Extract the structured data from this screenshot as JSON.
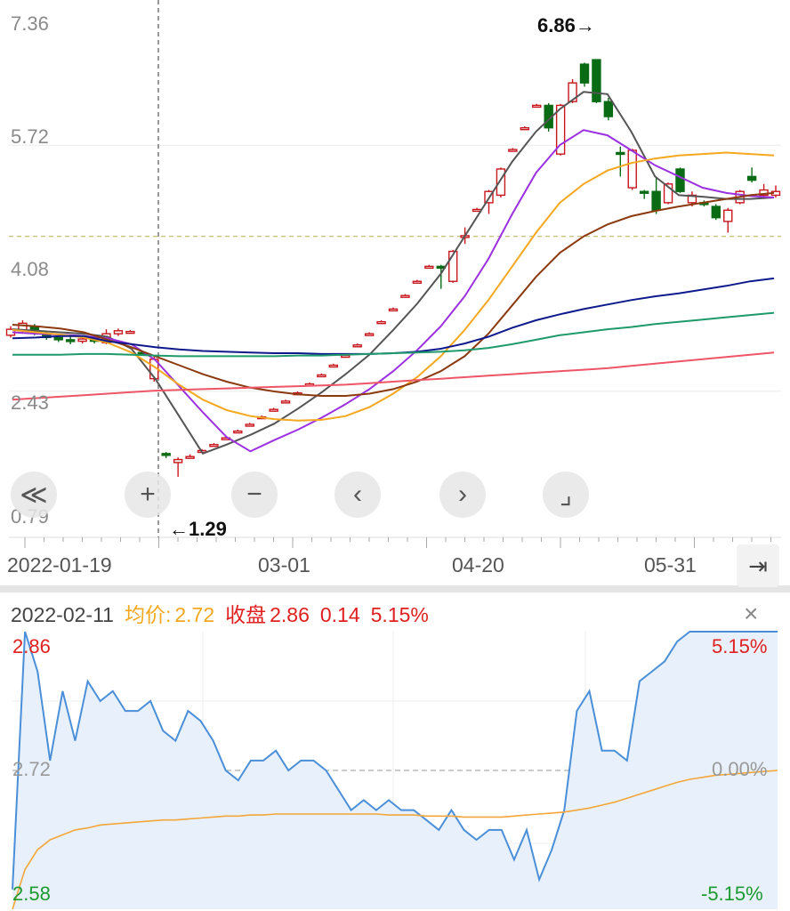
{
  "chart_data": [
    {
      "type": "candlestick",
      "y_ticks": [
        "7.36",
        "5.72",
        "4.08",
        "2.43",
        "0.79"
      ],
      "ylim": [
        0.79,
        7.36
      ],
      "x_ticks": [
        "2022-01-19",
        "03-01",
        "04-20",
        "05-31"
      ],
      "high_label": "6.86→",
      "low_label": "←1.29",
      "cursor_date": "2022-02-11",
      "candles": [
        {
          "o": 3.18,
          "c": 3.26,
          "h": 3.3,
          "l": 3.15
        },
        {
          "o": 3.24,
          "c": 3.34,
          "h": 3.38,
          "l": 3.2
        },
        {
          "o": 3.3,
          "c": 3.22,
          "h": 3.33,
          "l": 3.18
        },
        {
          "o": 3.2,
          "c": 3.15,
          "h": 3.24,
          "l": 3.12
        },
        {
          "o": 3.15,
          "c": 3.12,
          "h": 3.18,
          "l": 3.09
        },
        {
          "o": 3.12,
          "c": 3.1,
          "h": 3.16,
          "l": 3.06
        },
        {
          "o": 3.1,
          "c": 3.13,
          "h": 3.16,
          "l": 3.07
        },
        {
          "o": 3.14,
          "c": 3.1,
          "h": 3.19,
          "l": 3.07
        },
        {
          "o": 3.08,
          "c": 3.2,
          "h": 3.26,
          "l": 3.06
        },
        {
          "o": 3.2,
          "c": 3.24,
          "h": 3.27,
          "l": 3.17
        },
        {
          "o": 3.22,
          "c": 3.23,
          "h": 3.25,
          "l": 3.2
        },
        {
          "o": 2.95,
          "c": 2.93,
          "h": 2.97,
          "l": 2.91
        },
        {
          "o": 2.6,
          "c": 2.86,
          "h": 2.9,
          "l": 2.56
        },
        {
          "o": 1.6,
          "c": 1.59,
          "h": 1.62,
          "l": 1.54
        },
        {
          "o": 1.48,
          "c": 1.52,
          "h": 1.55,
          "l": 1.29
        },
        {
          "o": 1.55,
          "c": 1.56,
          "h": 1.59,
          "l": 1.54
        },
        {
          "o": 1.63,
          "c": 1.64,
          "h": 1.66,
          "l": 1.62
        },
        {
          "o": 1.71,
          "c": 1.72,
          "h": 1.74,
          "l": 1.7
        },
        {
          "o": 1.8,
          "c": 1.81,
          "h": 1.83,
          "l": 1.79
        },
        {
          "o": 1.89,
          "c": 1.9,
          "h": 1.92,
          "l": 1.88
        },
        {
          "o": 1.98,
          "c": 1.99,
          "h": 2.01,
          "l": 1.97
        },
        {
          "o": 2.08,
          "c": 2.09,
          "h": 2.11,
          "l": 2.07
        },
        {
          "o": 2.18,
          "c": 2.19,
          "h": 2.21,
          "l": 2.17
        },
        {
          "o": 2.29,
          "c": 2.3,
          "h": 2.32,
          "l": 2.28
        },
        {
          "o": 2.4,
          "c": 2.41,
          "h": 2.43,
          "l": 2.39
        },
        {
          "o": 2.52,
          "c": 2.53,
          "h": 2.55,
          "l": 2.51
        },
        {
          "o": 2.64,
          "c": 2.65,
          "h": 2.67,
          "l": 2.63
        },
        {
          "o": 2.77,
          "c": 2.78,
          "h": 2.8,
          "l": 2.76
        },
        {
          "o": 2.9,
          "c": 2.91,
          "h": 2.93,
          "l": 2.89
        },
        {
          "o": 3.04,
          "c": 3.05,
          "h": 3.07,
          "l": 3.03
        },
        {
          "o": 3.19,
          "c": 3.2,
          "h": 3.22,
          "l": 3.18
        },
        {
          "o": 3.35,
          "c": 3.36,
          "h": 3.38,
          "l": 3.34
        },
        {
          "o": 3.52,
          "c": 3.53,
          "h": 3.55,
          "l": 3.51
        },
        {
          "o": 3.7,
          "c": 3.71,
          "h": 3.73,
          "l": 3.69
        },
        {
          "o": 3.89,
          "c": 3.9,
          "h": 3.92,
          "l": 3.88
        },
        {
          "o": 4.09,
          "c": 4.1,
          "h": 4.12,
          "l": 4.08
        },
        {
          "o": 4.1,
          "c": 4.08,
          "h": 4.12,
          "l": 3.8
        },
        {
          "o": 3.9,
          "c": 4.3,
          "h": 4.32,
          "l": 3.88
        },
        {
          "o": 4.5,
          "c": 4.51,
          "h": 4.62,
          "l": 4.4
        },
        {
          "o": 4.85,
          "c": 4.86,
          "h": 4.88,
          "l": 4.84
        },
        {
          "o": 4.95,
          "c": 5.1,
          "h": 5.12,
          "l": 4.8
        },
        {
          "o": 5.05,
          "c": 5.4,
          "h": 5.42,
          "l": 5.02
        },
        {
          "o": 5.65,
          "c": 5.66,
          "h": 5.68,
          "l": 5.64
        },
        {
          "o": 5.94,
          "c": 5.95,
          "h": 5.97,
          "l": 5.93
        },
        {
          "o": 6.24,
          "c": 6.25,
          "h": 6.27,
          "l": 6.23
        },
        {
          "o": 6.25,
          "c": 5.95,
          "h": 6.28,
          "l": 5.9
        },
        {
          "o": 5.6,
          "c": 6.25,
          "h": 6.27,
          "l": 5.58
        },
        {
          "o": 6.3,
          "c": 6.55,
          "h": 6.6,
          "l": 6.28
        },
        {
          "o": 6.8,
          "c": 6.55,
          "h": 6.82,
          "l": 6.5
        },
        {
          "o": 6.86,
          "c": 6.3,
          "h": 6.86,
          "l": 6.28
        },
        {
          "o": 6.3,
          "c": 6.1,
          "h": 6.35,
          "l": 6.05
        },
        {
          "o": 5.62,
          "c": 5.6,
          "h": 5.7,
          "l": 5.3
        },
        {
          "o": 5.15,
          "c": 5.65,
          "h": 5.67,
          "l": 5.12
        },
        {
          "o": 5.1,
          "c": 5.08,
          "h": 5.12,
          "l": 5.0
        },
        {
          "o": 5.1,
          "c": 4.85,
          "h": 5.3,
          "l": 4.8
        },
        {
          "o": 4.95,
          "c": 5.2,
          "h": 5.22,
          "l": 4.93
        },
        {
          "o": 5.4,
          "c": 5.1,
          "h": 5.42,
          "l": 5.08
        },
        {
          "o": 4.95,
          "c": 5.05,
          "h": 5.1,
          "l": 4.9
        },
        {
          "o": 4.95,
          "c": 4.93,
          "h": 4.98,
          "l": 4.9
        },
        {
          "o": 4.9,
          "c": 4.75,
          "h": 4.93,
          "l": 4.72
        },
        {
          "o": 4.7,
          "c": 4.85,
          "h": 4.88,
          "l": 4.55
        },
        {
          "o": 4.95,
          "c": 5.1,
          "h": 5.12,
          "l": 4.93
        },
        {
          "o": 5.3,
          "c": 5.25,
          "h": 5.42,
          "l": 5.22
        },
        {
          "o": 5.05,
          "c": 5.12,
          "h": 5.2,
          "l": 5.0
        },
        {
          "o": 5.05,
          "c": 5.1,
          "h": 5.18,
          "l": 5.02
        }
      ],
      "series": [
        {
          "color": "#555555",
          "values": [
            3.26,
            3.24,
            3.22,
            3.2,
            3.16,
            3.0,
            2.6,
            2.1,
            1.6,
            1.72,
            1.85,
            2.0,
            2.2,
            2.42,
            2.66,
            2.92,
            3.25,
            3.6,
            4.0,
            4.5,
            5.0,
            5.5,
            5.9,
            6.2,
            6.43,
            6.4,
            5.9,
            5.3,
            5.05,
            5.03,
            5.0,
            5.0,
            5.02
          ]
        },
        {
          "color": "#9b30e0",
          "values": [
            3.22,
            3.2,
            3.19,
            3.17,
            3.14,
            3.06,
            2.85,
            2.5,
            2.15,
            1.82,
            1.63,
            1.78,
            1.92,
            2.08,
            2.26,
            2.46,
            2.7,
            2.98,
            3.3,
            3.7,
            4.2,
            4.8,
            5.35,
            5.72,
            5.92,
            5.85,
            5.65,
            5.45,
            5.3,
            5.15,
            5.08,
            5.04,
            5.02
          ]
        },
        {
          "color": "#f3a820",
          "values": [
            3.25,
            3.22,
            3.19,
            3.15,
            3.08,
            2.95,
            2.75,
            2.52,
            2.32,
            2.18,
            2.1,
            2.06,
            2.04,
            2.05,
            2.1,
            2.22,
            2.4,
            2.62,
            2.9,
            3.25,
            3.65,
            4.1,
            4.55,
            4.95,
            5.2,
            5.38,
            5.48,
            5.54,
            5.58,
            5.6,
            5.62,
            5.6,
            5.58
          ]
        },
        {
          "color": "#8b3a0f",
          "values": [
            3.32,
            3.3,
            3.27,
            3.22,
            3.12,
            3.02,
            2.9,
            2.78,
            2.66,
            2.56,
            2.48,
            2.43,
            2.39,
            2.37,
            2.37,
            2.4,
            2.46,
            2.56,
            2.7,
            2.9,
            3.2,
            3.58,
            3.96,
            4.28,
            4.5,
            4.66,
            4.77,
            4.84,
            4.9,
            4.95,
            5.0,
            5.05,
            5.08
          ]
        },
        {
          "color": "#0e1a8c",
          "values": [
            3.14,
            3.15,
            3.17,
            3.17,
            3.1,
            3.06,
            3.02,
            2.99,
            2.97,
            2.96,
            2.95,
            2.94,
            2.94,
            2.93,
            2.93,
            2.93,
            2.94,
            2.96,
            3.0,
            3.07,
            3.16,
            3.28,
            3.38,
            3.46,
            3.53,
            3.59,
            3.65,
            3.7,
            3.74,
            3.79,
            3.84,
            3.9,
            3.94
          ]
        },
        {
          "color": "#1f9a6a",
          "values": [
            2.92,
            2.92,
            2.92,
            2.93,
            2.93,
            2.92,
            2.91,
            2.9,
            2.9,
            2.9,
            2.9,
            2.9,
            2.91,
            2.91,
            2.92,
            2.93,
            2.94,
            2.95,
            2.96,
            2.98,
            3.01,
            3.06,
            3.12,
            3.18,
            3.22,
            3.26,
            3.29,
            3.33,
            3.36,
            3.39,
            3.42,
            3.45,
            3.48
          ]
        },
        {
          "color": "#ee5566",
          "values": [
            2.32,
            2.34,
            2.36,
            2.38,
            2.4,
            2.42,
            2.44,
            2.45,
            2.46,
            2.47,
            2.48,
            2.49,
            2.5,
            2.51,
            2.52,
            2.54,
            2.56,
            2.58,
            2.6,
            2.62,
            2.64,
            2.66,
            2.68,
            2.7,
            2.72,
            2.74,
            2.77,
            2.8,
            2.83,
            2.86,
            2.89,
            2.92,
            2.95
          ]
        }
      ]
    },
    {
      "type": "line",
      "date": "2022-02-11",
      "avg_label": "均价:",
      "avg_value": "2.72",
      "close_label": "收盘",
      "close_value": "2.86",
      "change": "0.14",
      "change_pct": "5.15%",
      "y_left_ticks": [
        "2.86",
        "2.72",
        "2.58"
      ],
      "y_right_ticks": [
        "5.15%",
        "0.00%",
        "-5.15%"
      ],
      "ylim": [
        2.58,
        2.86
      ],
      "series": [
        {
          "color": "#4a8fd8",
          "values": [
            2.6,
            2.86,
            2.82,
            2.73,
            2.8,
            2.75,
            2.81,
            2.79,
            2.8,
            2.78,
            2.78,
            2.79,
            2.76,
            2.75,
            2.78,
            2.77,
            2.75,
            2.72,
            2.71,
            2.73,
            2.73,
            2.74,
            2.72,
            2.73,
            2.73,
            2.72,
            2.7,
            2.68,
            2.69,
            2.68,
            2.69,
            2.68,
            2.68,
            2.67,
            2.66,
            2.68,
            2.66,
            2.65,
            2.66,
            2.66,
            2.63,
            2.66,
            2.61,
            2.64,
            2.68,
            2.78,
            2.8,
            2.74,
            2.74,
            2.73,
            2.81,
            2.82,
            2.83,
            2.85,
            2.86,
            2.86,
            2.86,
            2.86,
            2.86,
            2.86,
            2.86,
            2.86
          ]
        },
        {
          "color": "#f4a63a",
          "values": [
            2.58,
            2.62,
            2.64,
            2.65,
            2.655,
            2.66,
            2.662,
            2.665,
            2.666,
            2.667,
            2.668,
            2.669,
            2.67,
            2.67,
            2.671,
            2.672,
            2.673,
            2.674,
            2.674,
            2.675,
            2.675,
            2.676,
            2.676,
            2.676,
            2.676,
            2.676,
            2.676,
            2.676,
            2.676,
            2.676,
            2.675,
            2.675,
            2.675,
            2.674,
            2.674,
            2.674,
            2.673,
            2.673,
            2.673,
            2.673,
            2.674,
            2.675,
            2.676,
            2.677,
            2.678,
            2.68,
            2.682,
            2.685,
            2.688,
            2.692,
            2.696,
            2.7,
            2.704,
            2.708,
            2.711,
            2.713,
            2.715,
            2.716,
            2.717,
            2.718,
            2.719,
            2.72
          ]
        }
      ]
    }
  ],
  "controls": {
    "rewind": "≪",
    "zoom_in": "+",
    "zoom_out": "−",
    "prev": "‹",
    "next": "›",
    "fullscreen": "⌟",
    "to_end": "⇥",
    "close": "×"
  }
}
